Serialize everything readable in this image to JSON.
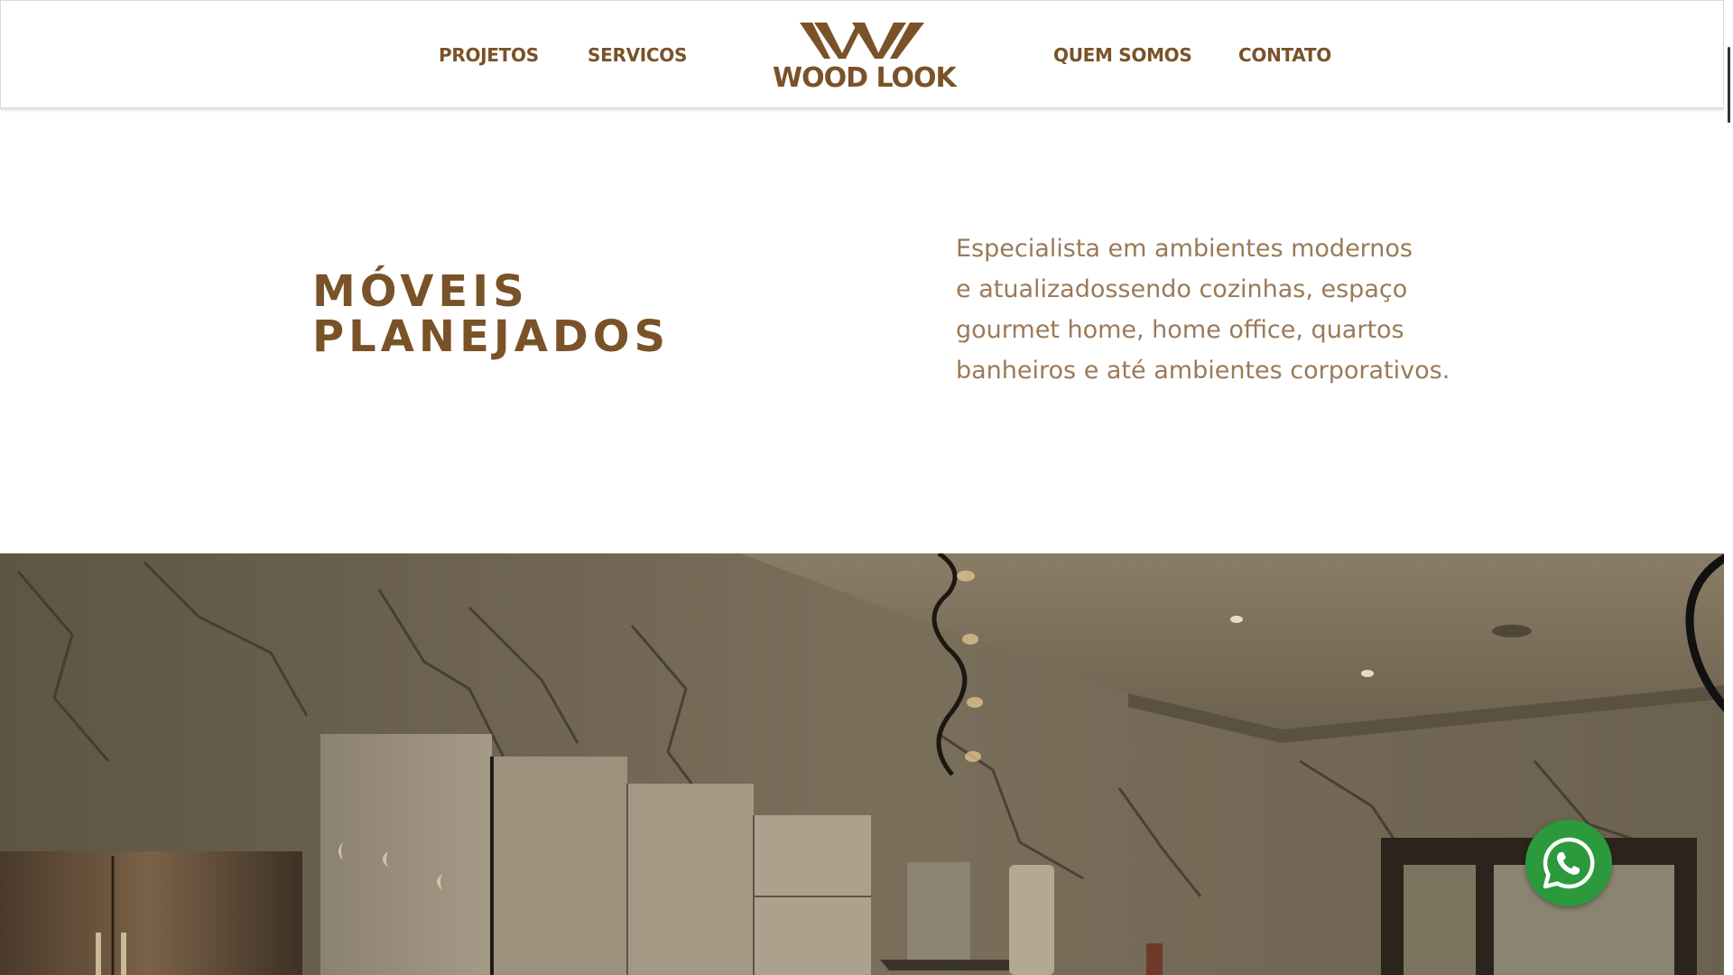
{
  "nav": {
    "left": [
      {
        "label": "PROJETOS"
      },
      {
        "label": "SERVICOS"
      }
    ],
    "right": [
      {
        "label": "QUEM SOMOS"
      },
      {
        "label": "CONTATO"
      }
    ]
  },
  "logo": {
    "text": "WOOD LOOK",
    "color": "#7a5228"
  },
  "intro": {
    "title_lines": [
      "MÓVEIS",
      "PLANEJADOS"
    ],
    "description_lines": [
      "Especialista em ambientes modernos",
      "e atualizadossendo cozinhas, espaço",
      "gourmet home, home office, quartos",
      "banheiros e até ambientes corporativos."
    ]
  },
  "hero": {
    "icon": "kitchen-photo"
  },
  "whatsapp": {
    "icon": "whatsapp-icon",
    "color": "#2a9a3d"
  },
  "colors": {
    "brand": "#7a5228",
    "text_light": "#9a7a58"
  }
}
